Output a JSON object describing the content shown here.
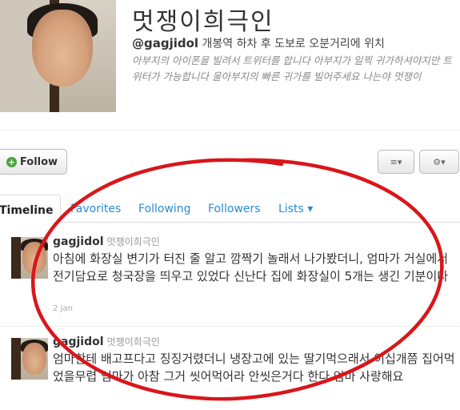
{
  "profile": {
    "name": "멋쟁이희극인",
    "handle": "@gagjidol",
    "location": "개봉역 하차 후 도보로 오분거리에 위치",
    "bio": "아부지의 아이폰을 빌려서 트위터를 합니다 아부지가 일찍 귀가하셔야지만 트위터가 가능합니다 울아부지의 빠른 귀가를 빌어주세요 나는야 멋쟁이"
  },
  "actions": {
    "follow_label": "Follow",
    "list_label": "≡▾",
    "gear_label": "⚙▾"
  },
  "tabs": [
    {
      "label": "Timeline"
    },
    {
      "label": "Favorites"
    },
    {
      "label": "Following"
    },
    {
      "label": "Followers"
    },
    {
      "label": "Lists ▾"
    }
  ],
  "tweets": [
    {
      "user": "gagjidol",
      "real_name": "멋쟁이희극인",
      "text": "아침에 화장실 변기가 터진 줄 알고 깜짝기 놀래서 나가봤더니, 엄마가 거실에서 전기담요로 청국장을 띄우고 있었다 신난다 집에 화장실이 5개는 생긴 기분이다",
      "date": "2 Jan"
    },
    {
      "user": "gagjidol",
      "real_name": "멋쟁이희극인",
      "text": "엄마한테 배고프다고 징징거렸더니 냉장고에 있는 딸기먹으래서 이십개쯤 집어먹었을무렵 엄마가 아참 그거 씻어먹어라 안씻은거다 한다 엄마 사랑해요",
      "date": ""
    }
  ],
  "annotation_color": "#d9161b"
}
